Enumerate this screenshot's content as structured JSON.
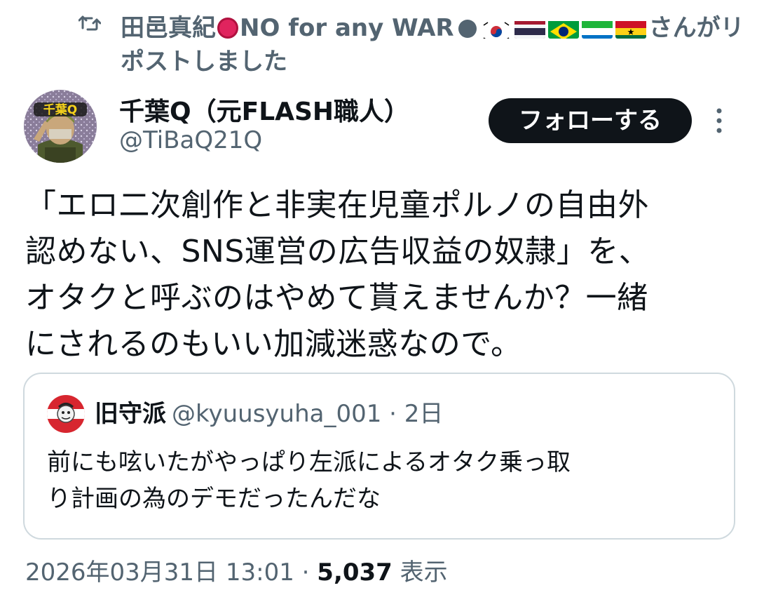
{
  "repost": {
    "user_name": "田邑真紀",
    "user_badge_text": "NO for any WAR",
    "suffix": "さんがリポストしました",
    "flags": [
      "kr-flag",
      "th-flag",
      "br-flag",
      "sl-flag",
      "gh-flag"
    ]
  },
  "author": {
    "name": "千葉Q（元FLASH職人）",
    "handle": "@TiBaQ21Q",
    "avatar_text": "千葉Q"
  },
  "follow_button": "フォローする",
  "tweet": {
    "lines": [
      "「エロ二次創作と非実在児童ポルノの自由外",
      "認めない、SNS運営の広告収益の奴隷」を、",
      "オタクと呼ぶのはやめて貰えませんか？一緒",
      "にされるのもいい加減迷惑なので。"
    ]
  },
  "quote": {
    "name": "旧守派",
    "handle": "@kyuusyuha_001",
    "separator": "·",
    "date": "2日",
    "lines": [
      "前にも呟いたがやっぱり左派によるオタク乗っ取",
      "り計画の為のデモだったんだな"
    ]
  },
  "meta": {
    "timestamp": "2026年03月31日 13:01",
    "separator": "·",
    "views": "5,037",
    "views_label": "表示"
  },
  "colors": {
    "text_primary": "#0f1419",
    "text_secondary": "#536471",
    "border": "#cfd9de",
    "button_bg": "#0f1419"
  }
}
